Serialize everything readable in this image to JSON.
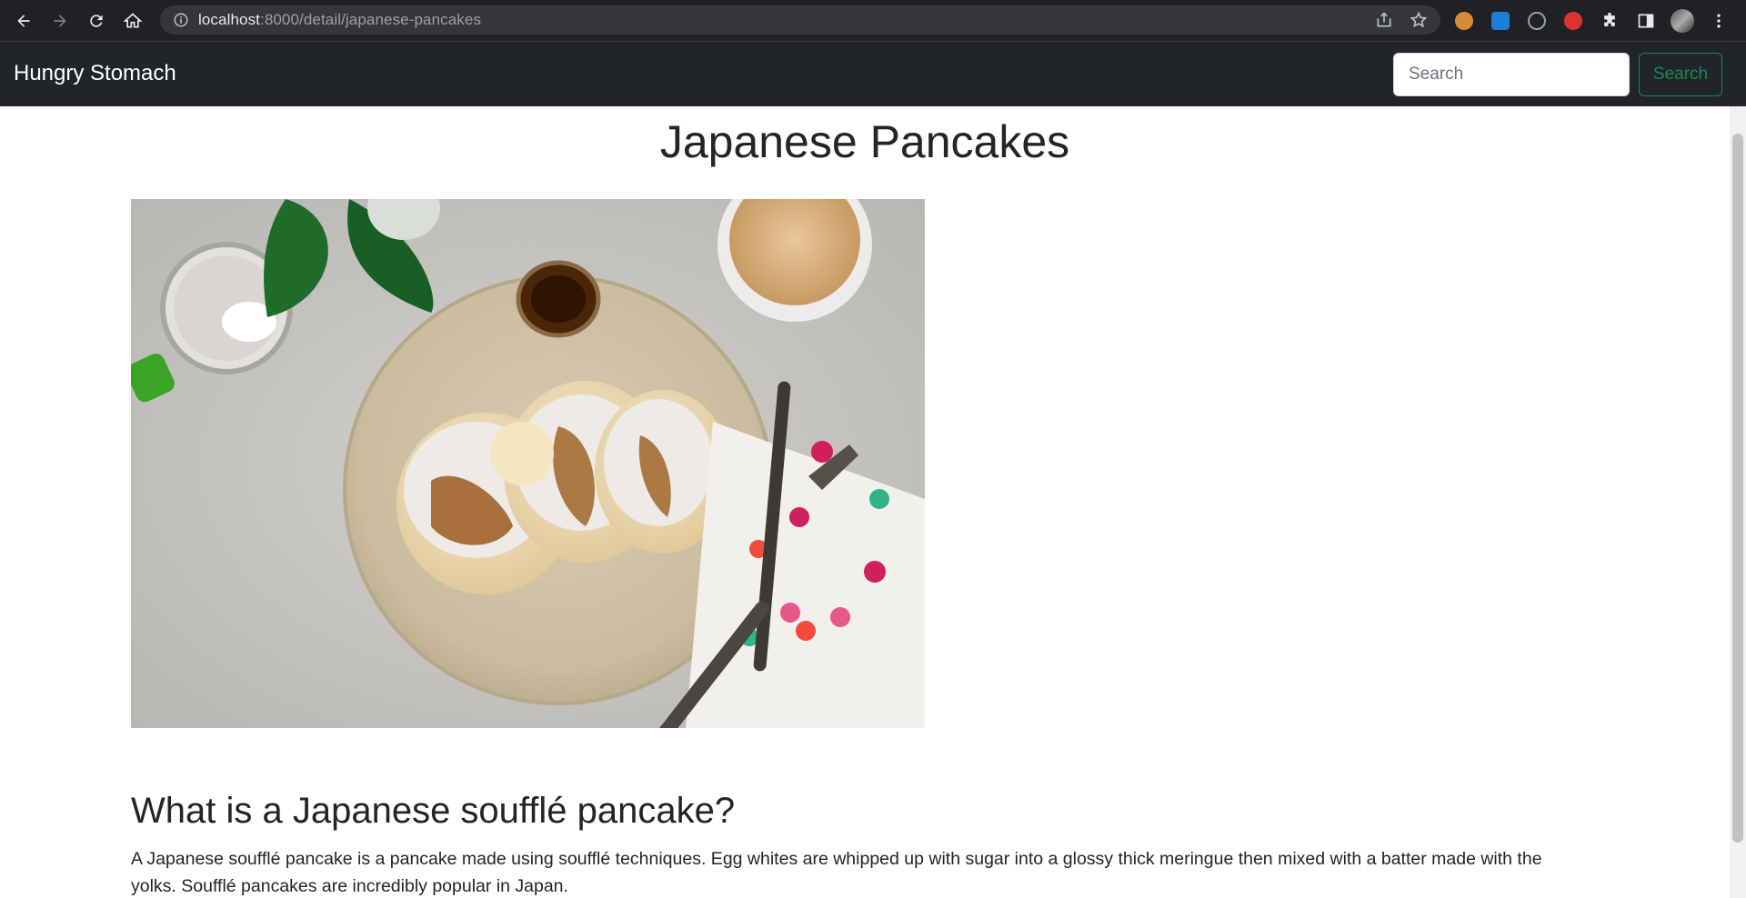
{
  "browser": {
    "url_host": "localhost",
    "url_rest": ":8000/detail/japanese-pancakes"
  },
  "navbar": {
    "brand": "Hungry Stomach",
    "search_placeholder": "Search",
    "search_button": "Search",
    "accent_color": "#198754"
  },
  "recipe": {
    "title": "Japanese Pancakes",
    "section_title": "What is a Japanese soufflé pancake?",
    "description": "A Japanese soufflé pancake is a pancake made using soufflé techniques. Egg whites are whipped up with sugar into a glossy thick meringue then mixed with a batter made with the yolks. Soufflé pancakes are incredibly popular in Japan."
  },
  "icons": [
    "back-icon",
    "forward-icon",
    "reload-icon",
    "home-icon",
    "info-icon",
    "share-icon",
    "star-icon",
    "extensions-icon",
    "sidebar-icon",
    "menu-icon"
  ]
}
